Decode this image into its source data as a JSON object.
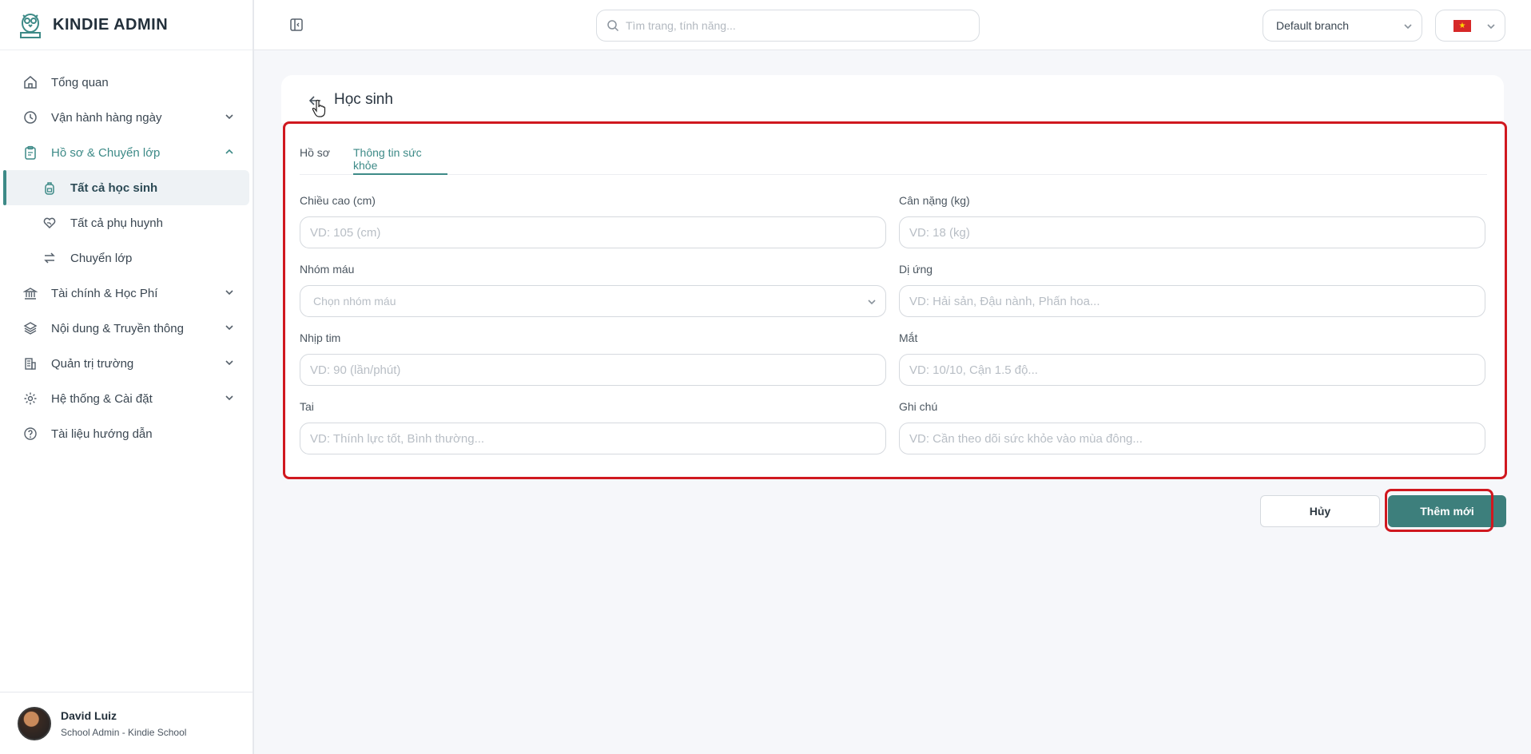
{
  "app": {
    "brand": "KINDIE ADMIN"
  },
  "sidebar": {
    "items": [
      {
        "label": "Tổng quan",
        "icon": "home-icon"
      },
      {
        "label": "Vận hành hàng ngày",
        "icon": "clock-icon"
      },
      {
        "label": "Hồ sơ & Chuyển lớp",
        "icon": "clipboard-icon"
      },
      {
        "label": "Tài chính & Học Phí",
        "icon": "bank-icon"
      },
      {
        "label": "Nội dung & Truyền thông",
        "icon": "layers-icon"
      },
      {
        "label": "Quản trị trường",
        "icon": "building-icon"
      },
      {
        "label": "Hệ thống & Cài đặt",
        "icon": "gear-icon"
      },
      {
        "label": "Tài liệu hướng dẫn",
        "icon": "help-icon"
      }
    ],
    "subitems": [
      {
        "label": "Tất cả học sinh",
        "icon": "backpack-icon"
      },
      {
        "label": "Tất cả phụ huynh",
        "icon": "heart-hand-icon"
      },
      {
        "label": "Chuyển lớp",
        "icon": "swap-icon"
      }
    ],
    "user": {
      "name": "David Luiz",
      "role": "School Admin - Kindie School"
    }
  },
  "topbar": {
    "search_placeholder": "Tìm trang, tính năng...",
    "branch": "Default branch",
    "language_flag": "vietnam-flag"
  },
  "page": {
    "title": "Học sinh",
    "tabs": [
      "Hồ sơ",
      "Thông tin sức khỏe"
    ],
    "active_tab": "Thông tin sức khỏe"
  },
  "form": {
    "height": {
      "label": "Chiều cao (cm)",
      "placeholder": "VD: 105 (cm)"
    },
    "weight": {
      "label": "Cân nặng (kg)",
      "placeholder": "VD: 18 (kg)"
    },
    "blood": {
      "label": "Nhóm máu",
      "placeholder": "Chọn nhóm máu"
    },
    "allergy": {
      "label": "Dị ứng",
      "placeholder": "VD: Hải sản, Đậu nành, Phấn hoa..."
    },
    "heart": {
      "label": "Nhịp tim",
      "placeholder": "VD: 90 (lần/phút)"
    },
    "eyes": {
      "label": "Mắt",
      "placeholder": "VD: 10/10, Cận 1.5 độ..."
    },
    "ears": {
      "label": "Tai",
      "placeholder": "VD: Thính lực tốt, Bình thường..."
    },
    "notes": {
      "label": "Ghi chú",
      "placeholder": "VD: Cần theo dõi sức khỏe vào mùa đông..."
    }
  },
  "actions": {
    "cancel": "Hủy",
    "submit": "Thêm mới"
  },
  "colors": {
    "accent": "#3d8a87",
    "button": "#3d7f7c",
    "highlight": "#d0181f"
  }
}
